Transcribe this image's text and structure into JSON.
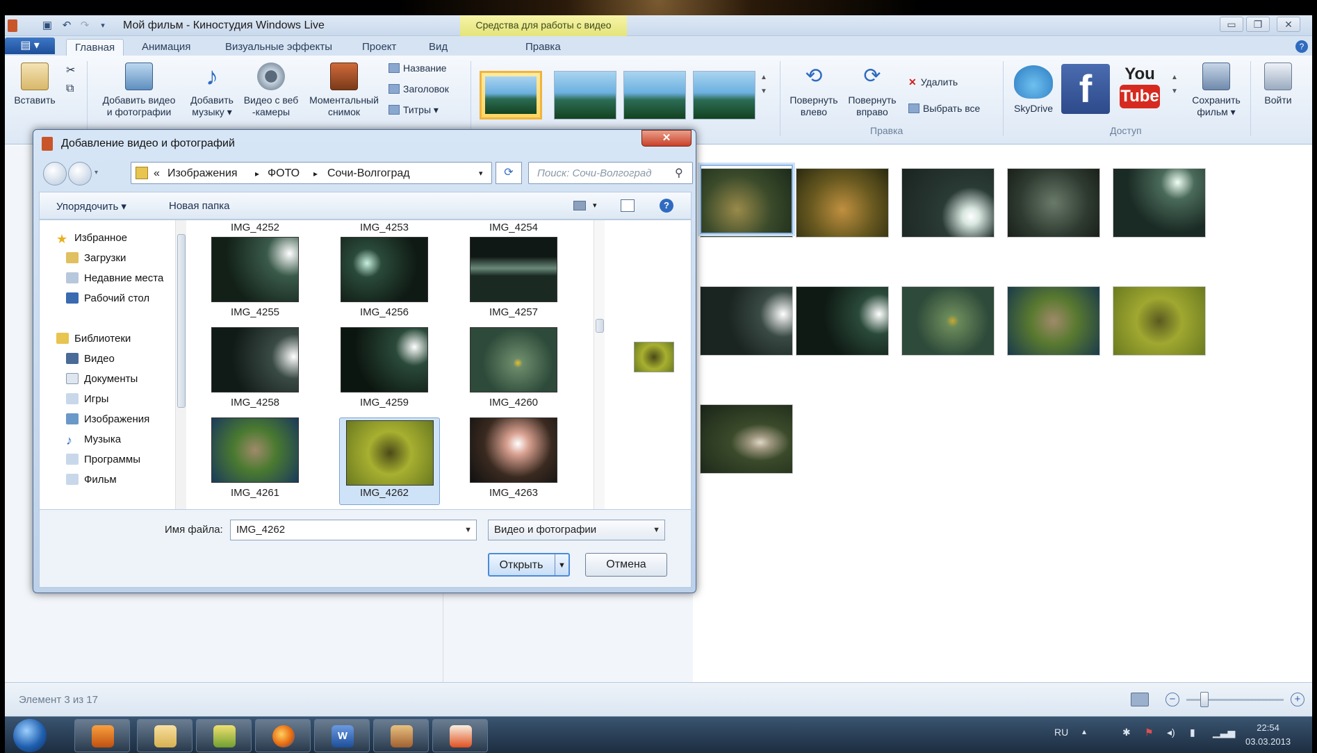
{
  "window": {
    "title": "Мой фильм - Киностудия Windows Live",
    "context_tab": "Средства для работы с видео",
    "file_button": "▤ ▾"
  },
  "tabs": [
    "Главная",
    "Анимация",
    "Визуальные эффекты",
    "Проект",
    "Вид",
    "Правка"
  ],
  "ribbon": {
    "paste": "Вставить",
    "add_video": [
      "Добавить видео",
      "и фотографии"
    ],
    "add_music": [
      "Добавить",
      "музыку ▾"
    ],
    "webcam": [
      "Видео с веб",
      "-камеры"
    ],
    "snapshot": [
      "Моментальный",
      "снимок"
    ],
    "title_btn": "Название",
    "caption_btn": "Заголовок",
    "credits_btn": "Титры ▾",
    "rotate_left": [
      "Повернуть",
      "влево"
    ],
    "rotate_right": [
      "Повернуть",
      "вправо"
    ],
    "delete": "Удалить",
    "select_all": "Выбрать все",
    "group_edit": "Правка",
    "skydrive": "SkyDrive",
    "facebook": "f",
    "youtube_top": "You",
    "youtube_bottom": "Tube",
    "save_movie": [
      "Сохранить",
      "фильм ▾"
    ],
    "group_share": "Доступ",
    "signin": "Войти"
  },
  "dialog": {
    "title": "Добавление видео и фотографий",
    "breadcrumb": [
      "«",
      "Изображения",
      "▸",
      "ФОТО",
      "▸",
      "Сочи-Волгоград"
    ],
    "search_placeholder": "Поиск: Сочи-Волгоград",
    "organize": "Упорядочить ▾",
    "new_folder": "Новая папка",
    "nav": {
      "favorites": "Избранное",
      "downloads": "Загрузки",
      "recent": "Недавние места",
      "desktop": "Рабочий стол",
      "libraries": "Библиотеки",
      "video": "Видео",
      "documents": "Документы",
      "games": "Игры",
      "images": "Изображения",
      "music": "Музыка",
      "programs": "Программы",
      "film": "Фильм"
    },
    "top_captions": [
      "IMG_4252",
      "IMG_4253",
      "IMG_4254"
    ],
    "files": [
      "IMG_4255",
      "IMG_4256",
      "IMG_4257",
      "IMG_4258",
      "IMG_4259",
      "IMG_4260",
      "IMG_4261",
      "IMG_4262",
      "IMG_4263"
    ],
    "filename_label": "Имя файла:",
    "filename_value": "IMG_4262",
    "filetype": "Видео и фотографии",
    "open": "Открыть",
    "cancel": "Отмена"
  },
  "status": {
    "text": "Элемент 3 из 17"
  },
  "tray": {
    "lang": "RU",
    "time": "22:54",
    "date": "03.03.2013"
  }
}
